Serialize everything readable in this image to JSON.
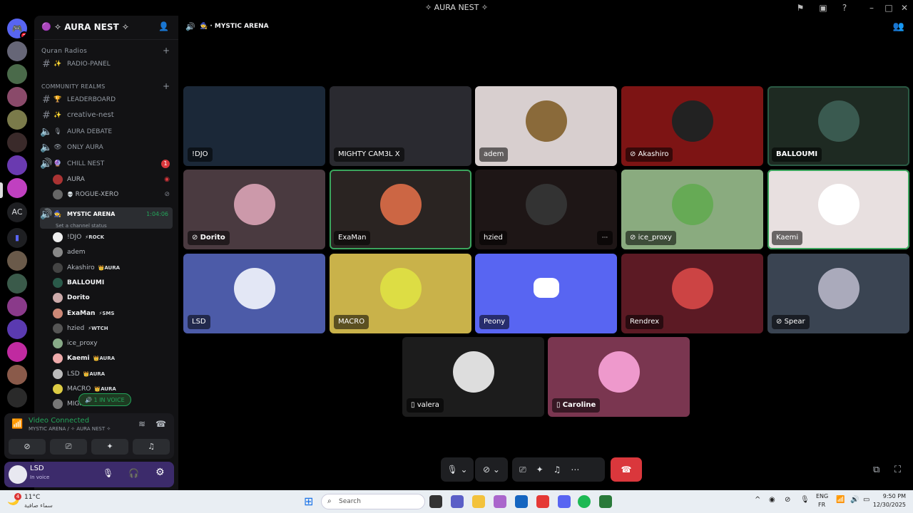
{
  "window": {
    "title": "✧ AURA NEST ✧"
  },
  "server": {
    "name": "✧ AURA NEST ✧"
  },
  "sidebar": {
    "quran_radios": "Quran Radios",
    "radio_panel": "RADIO-PANEL",
    "community_realms": "COMMUNITY REALMS",
    "leaderboard": "LEADERBOARD",
    "creative_nest": "creative-nest",
    "aura_debate": "AURA DEBATE",
    "only_aura": "ONLY AURA",
    "chill_nest": "CHILL NEST",
    "chill_badge": "1",
    "chill_users": [
      {
        "name": "AURA"
      },
      {
        "name": "ROGUE-XERO"
      }
    ],
    "mystic_arena": "MYSTIC ARENA",
    "mystic_time": "1:04:06",
    "channel_status": "Set a channel status",
    "mystic_users": [
      {
        "name": "!DJO",
        "tag": "⚡ROCK"
      },
      {
        "name": "adem",
        "tag": ""
      },
      {
        "name": "Akashiro",
        "tag": "👑AURA"
      },
      {
        "name": "BALLOUMI",
        "tag": ""
      },
      {
        "name": "Dorito",
        "tag": ""
      },
      {
        "name": "ExaMan",
        "tag": "⚡SMS"
      },
      {
        "name": "hzied",
        "tag": "⚡WTCH"
      },
      {
        "name": "ice_proxy",
        "tag": ""
      },
      {
        "name": "Kaemi",
        "tag": "👑AURA"
      },
      {
        "name": "LSD",
        "tag": "👑AURA"
      },
      {
        "name": "MACRO",
        "tag": "👑AURA"
      },
      {
        "name": "MIGH",
        "tag": ""
      }
    ],
    "in_voice_pill": "1 IN VOICE"
  },
  "voice_panel": {
    "status": "Video Connected",
    "sub": "MYSTIC ARENA / ✧ AURA NEST ✧"
  },
  "user": {
    "name": "LSD",
    "status": "In voice"
  },
  "stage": {
    "header": "MYSTIC ARENA",
    "tiles": [
      {
        "name": "!DJO"
      },
      {
        "name": "MIGHTY CAM3L X"
      },
      {
        "name": "adem"
      },
      {
        "name": "Akashiro"
      },
      {
        "name": "BALLOUMI"
      },
      {
        "name": "Dorito"
      },
      {
        "name": "ExaMan"
      },
      {
        "name": "hzied"
      },
      {
        "name": "ice_proxy"
      },
      {
        "name": "Kaemi"
      },
      {
        "name": "LSD"
      },
      {
        "name": "MACRO"
      },
      {
        "name": "Peony"
      },
      {
        "name": "Rendrex"
      },
      {
        "name": "Spear"
      },
      {
        "name": "valera"
      },
      {
        "name": "Caroline"
      }
    ],
    "more": "···"
  },
  "taskbar": {
    "weather_temp": "11°C",
    "weather_desc": "سماء صافية",
    "weather_badge": "4",
    "search_placeholder": "Search",
    "lang": "ENG",
    "lang2": "FR",
    "time": "9:50 PM",
    "date": "12/30/2025"
  },
  "server_list": {
    "dm_badge": "2",
    "ac_label": "AC"
  },
  "colors": {
    "accent_green": "#23a55a",
    "blurple": "#5865f2",
    "danger": "#da373c"
  }
}
